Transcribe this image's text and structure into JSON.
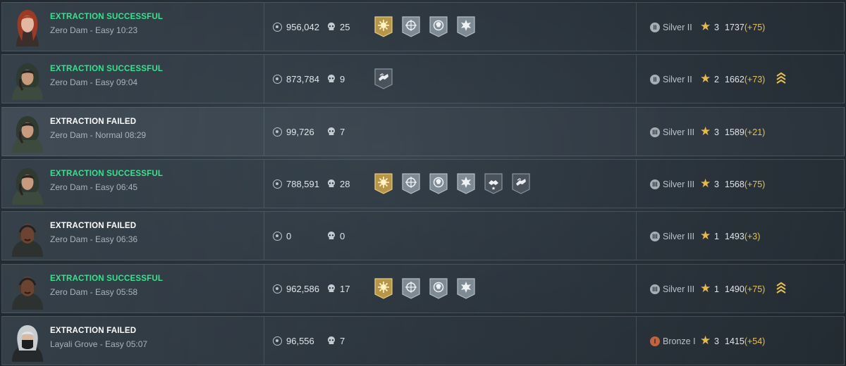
{
  "colors": {
    "success": "#36e38e",
    "failed": "#ffffff",
    "gain": "#e4c15a",
    "gold_medal": "#b7964a",
    "grey_medal": "#7e8a94"
  },
  "matches": [
    {
      "status": "EXTRACTION SUCCESSFUL",
      "result": "success",
      "map": "Zero Dam - Easy 10:23",
      "money": "956,042",
      "kills": "25",
      "medals": [
        "gold-sun-medal",
        "scope-medal",
        "skull-shield-medal",
        "star-burst-medal"
      ],
      "rank": "Silver II",
      "rank_tier": "silver",
      "rank_icon": "II",
      "stars": "3",
      "score": "1737",
      "gain": "(+75)",
      "promotion": false,
      "avatar": "red-hair-operator"
    },
    {
      "status": "EXTRACTION SUCCESSFUL",
      "result": "success",
      "map": "Zero Dam - Easy 09:04",
      "money": "873,784",
      "kills": "9",
      "medals": [
        "handshake-medal-dark"
      ],
      "rank": "Silver II",
      "rank_tier": "silver",
      "rank_icon": "II",
      "stars": "2",
      "score": "1662",
      "gain": "(+73)",
      "promotion": true,
      "avatar": "hooded-operator"
    },
    {
      "status": "EXTRACTION FAILED",
      "result": "failed",
      "map": "Zero Dam - Normal 08:29",
      "money": "99,726",
      "kills": "7",
      "medals": [],
      "rank": "Silver III",
      "rank_tier": "silver",
      "rank_icon": "III",
      "stars": "3",
      "score": "1589",
      "gain": "(+21)",
      "promotion": false,
      "avatar": "hooded-operator"
    },
    {
      "status": "EXTRACTION SUCCESSFUL",
      "result": "success",
      "map": "Zero Dam - Easy 06:45",
      "money": "788,591",
      "kills": "28",
      "medals": [
        "gold-sun-medal",
        "scope-medal",
        "skull-shield-medal",
        "star-burst-medal",
        "handshake-star-medal",
        "handshake-medal-dark"
      ],
      "rank": "Silver III",
      "rank_tier": "silver",
      "rank_icon": "III",
      "stars": "3",
      "score": "1568",
      "gain": "(+75)",
      "promotion": false,
      "avatar": "hooded-operator"
    },
    {
      "status": "EXTRACTION FAILED",
      "result": "failed",
      "map": "Zero Dam - Easy 06:36",
      "money": "0",
      "kills": "0",
      "medals": [],
      "rank": "Silver III",
      "rank_tier": "silver",
      "rank_icon": "III",
      "stars": "1",
      "score": "1493",
      "gain": "(+3)",
      "promotion": false,
      "avatar": "bald-headset-operator"
    },
    {
      "status": "EXTRACTION SUCCESSFUL",
      "result": "success",
      "map": "Zero Dam - Easy 05:58",
      "money": "962,586",
      "kills": "17",
      "medals": [
        "gold-sun-medal",
        "scope-medal",
        "skull-shield-medal",
        "star-burst-medal"
      ],
      "rank": "Silver III",
      "rank_tier": "silver",
      "rank_icon": "III",
      "stars": "1",
      "score": "1490",
      "gain": "(+75)",
      "promotion": true,
      "avatar": "bald-headset-operator"
    },
    {
      "status": "EXTRACTION FAILED",
      "result": "failed",
      "map": "Layali Grove - Easy 05:07",
      "money": "96,556",
      "kills": "7",
      "medals": [],
      "rank": "Bronze I",
      "rank_tier": "bronze",
      "rank_icon": "I",
      "stars": "3",
      "score": "1415",
      "gain": "(+54)",
      "promotion": false,
      "avatar": "masked-white-hair-operator"
    }
  ]
}
